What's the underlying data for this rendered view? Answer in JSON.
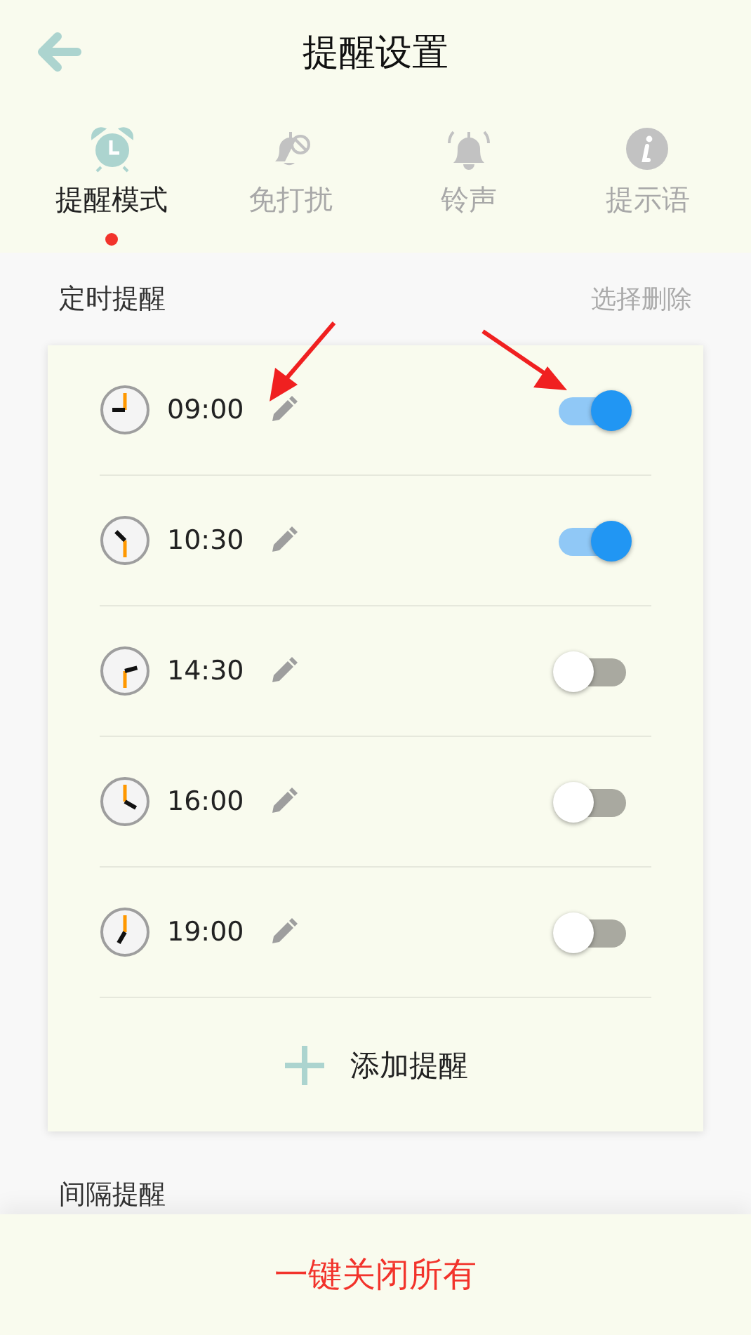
{
  "header": {
    "title": "提醒设置"
  },
  "tabs": [
    {
      "label": "提醒模式",
      "kind": "alarm",
      "selected": true
    },
    {
      "label": "免打扰",
      "kind": "mute",
      "selected": false
    },
    {
      "label": "铃声",
      "kind": "bell",
      "selected": false
    },
    {
      "label": "提示语",
      "kind": "info",
      "selected": false
    }
  ],
  "timed_section": {
    "title": "定时提醒",
    "action": "选择删除",
    "reminders": [
      {
        "time": "09:00",
        "on": true
      },
      {
        "time": "10:30",
        "on": true
      },
      {
        "time": "14:30",
        "on": false
      },
      {
        "time": "16:00",
        "on": false
      },
      {
        "time": "19:00",
        "on": false
      }
    ],
    "add_label": "添加提醒"
  },
  "interval_section": {
    "title": "间隔提醒"
  },
  "bottom_button": {
    "label": "一键关闭所有"
  }
}
